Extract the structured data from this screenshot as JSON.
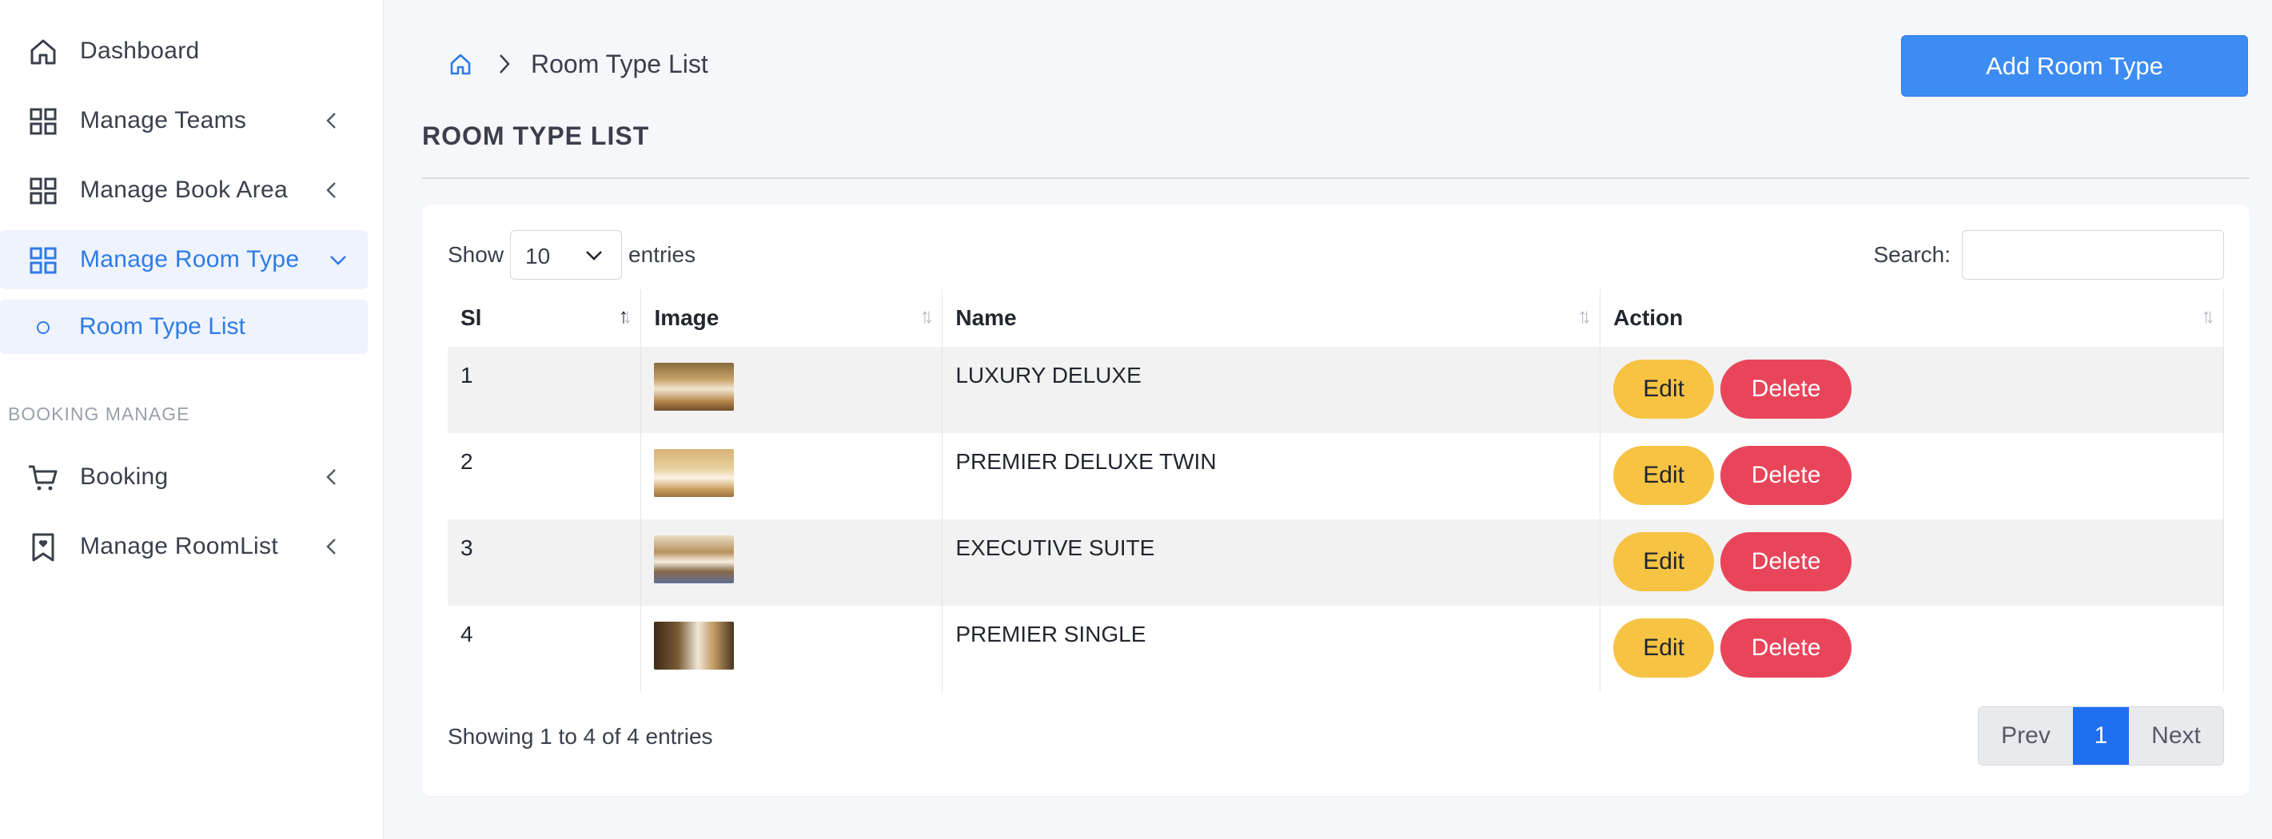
{
  "sidebar": {
    "items": [
      {
        "label": "Dashboard",
        "icon": "home-icon"
      },
      {
        "label": "Manage Teams",
        "icon": "grid-icon"
      },
      {
        "label": "Manage Book Area",
        "icon": "grid-icon"
      },
      {
        "label": "Manage Room Type",
        "icon": "grid-icon",
        "active": true
      },
      {
        "label": "Booking",
        "icon": "cart-icon"
      },
      {
        "label": "Manage RoomList",
        "icon": "bookmark-heart-icon"
      }
    ],
    "sub_item": "Room Type List",
    "section_label": "BOOKING MANAGE"
  },
  "header": {
    "breadcrumb": "Room Type List",
    "add_button": "Add Room Type"
  },
  "page_title": "ROOM TYPE LIST",
  "table_controls": {
    "show_label": "Show",
    "show_value": "10",
    "entries_label": "entries",
    "search_label": "Search:",
    "search_value": ""
  },
  "table": {
    "headers": [
      "Sl",
      "Image",
      "Name",
      "Action"
    ],
    "rows": [
      {
        "sl": "1",
        "name": "LUXURY DELUXE"
      },
      {
        "sl": "2",
        "name": "PREMIER DELUXE TWIN"
      },
      {
        "sl": "3",
        "name": "EXECUTIVE SUITE"
      },
      {
        "sl": "4",
        "name": "PREMIER SINGLE"
      }
    ],
    "edit_label": "Edit",
    "delete_label": "Delete"
  },
  "footer": {
    "showing": "Showing 1 to 4 of 4 entries",
    "prev": "Prev",
    "page": "1",
    "next": "Next"
  },
  "colors": {
    "accent": "#3c8cf3",
    "edit": "#f6c343",
    "delete": "#e9455a"
  }
}
